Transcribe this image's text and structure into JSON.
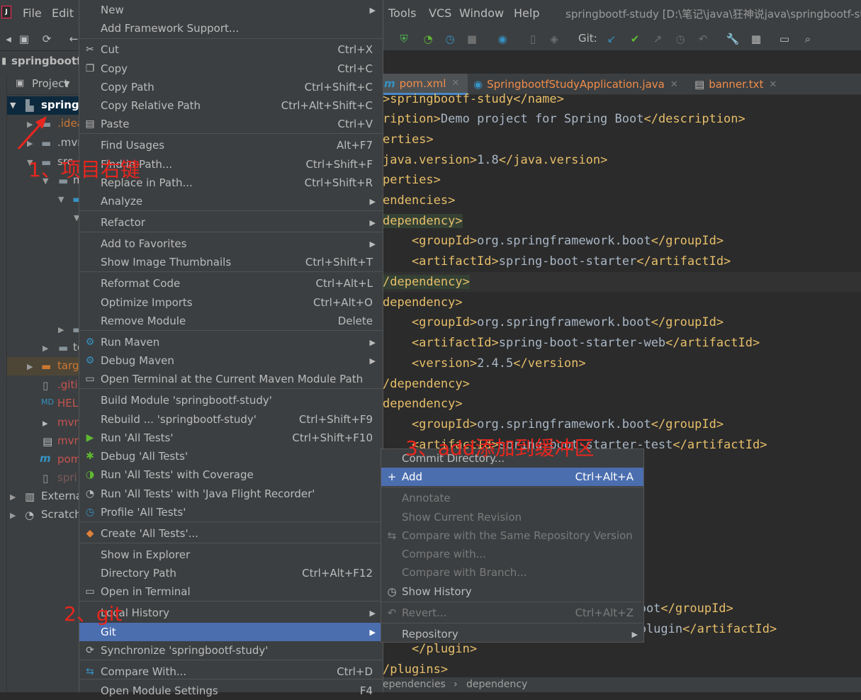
{
  "menubar": {
    "items": [
      "File",
      "Edit",
      "Tools",
      "VCS",
      "Window",
      "Help"
    ],
    "title": "springbootf-study [D:\\笔记\\java\\狂神说java\\springbootf-st"
  },
  "toolbar": {
    "git_label": "Git:"
  },
  "breadcrumb": {
    "project": "springbootf-"
  },
  "project_panel": {
    "header": "Project",
    "rows": [
      "springb",
      ".idea",
      ".mvn",
      "src",
      "m",
      "",
      "",
      "",
      "te",
      "target",
      ".giti",
      "HELI",
      "mvn",
      "mvn",
      "pom",
      "spri",
      "Externa",
      "Scratch"
    ]
  },
  "tabs": [
    {
      "label": "pom.xml"
    },
    {
      "label": "SpringbootfStudyApplication.java"
    },
    {
      "label": "banner.txt"
    }
  ],
  "editor": {
    "lines": [
      {
        "tag1": ">springbootf-study</",
        "tag2": "name>",
        "text": ""
      },
      {
        "tag1": "ription>",
        "text": "Demo project for Spring Boot",
        "tag2": "</description>"
      },
      {
        "tag1": "erties>",
        "text": "",
        "tag2": ""
      },
      {
        "tag1": "java.version>",
        "text": "1.8",
        "tag2": "</java.version>"
      },
      {
        "tag1": "perties>",
        "text": "",
        "tag2": ""
      },
      {
        "tag1": "endencies>",
        "text": "",
        "tag2": ""
      },
      {
        "tag1": "dependency>",
        "text": "",
        "tag2": ""
      },
      {
        "tag1": "    <groupId>",
        "text": "org.springframework.boot",
        "tag2": "</groupId>"
      },
      {
        "tag1": "    <artifactId>",
        "text": "spring-boot-starter",
        "tag2": "</artifactId>"
      },
      {
        "tag1": "/dependency>",
        "text": "",
        "tag2": ""
      },
      {
        "tag1": "dependency>",
        "text": "",
        "tag2": ""
      },
      {
        "tag1": "    <groupId>",
        "text": "org.springframework.boot",
        "tag2": "</groupId>"
      },
      {
        "tag1": "    <artifactId>",
        "text": "spring-boot-starter-web",
        "tag2": "</artifactId>"
      },
      {
        "tag1": "    <version>",
        "text": "2.4.5",
        "tag2": "</version>"
      },
      {
        "tag1": "/dependency>",
        "text": "",
        "tag2": ""
      },
      {
        "tag1": "dependency>",
        "text": "",
        "tag2": ""
      },
      {
        "tag1": "    <groupId>",
        "text": "org.springframework.boot",
        "tag2": "</groupId>"
      },
      {
        "tag1": "    <artifactId>",
        "text": "spring-boot-starter-test",
        "tag2": "</artifactId>"
      }
    ],
    "tail_lines": [
      {
        "tag1": "",
        "text": "k.boot",
        "tag2": "</groupId>"
      },
      {
        "tag1": "",
        "text": "en-plugin",
        "tag2": "</artifactId>"
      },
      {
        "tag1": "    </plugin>",
        "text": "",
        "tag2": ""
      },
      {
        "tag1": "/plugins>",
        "text": "",
        "tag2": ""
      }
    ]
  },
  "statusbar": {
    "crumb1": "ependencies",
    "sep": "›",
    "crumb2": "dependency"
  },
  "context_menu": {
    "items": [
      {
        "label": "New",
        "shortcut": "",
        "submenu": true
      },
      {
        "label": "Add Framework Support...",
        "shortcut": ""
      },
      {
        "label": "Cut",
        "shortcut": "Ctrl+X",
        "icon": "scissors-icon"
      },
      {
        "label": "Copy",
        "shortcut": "Ctrl+C",
        "icon": "copy-icon"
      },
      {
        "label": "Copy Path",
        "shortcut": "Ctrl+Shift+C"
      },
      {
        "label": "Copy Relative Path",
        "shortcut": "Ctrl+Alt+Shift+C"
      },
      {
        "label": "Paste",
        "shortcut": "Ctrl+V",
        "icon": "paste-icon"
      },
      {
        "label": "Find Usages",
        "shortcut": "Alt+F7"
      },
      {
        "label": "Find in Path...",
        "shortcut": "Ctrl+Shift+F"
      },
      {
        "label": "Replace in Path...",
        "shortcut": "Ctrl+Shift+R"
      },
      {
        "label": "Analyze",
        "shortcut": "",
        "submenu": true
      },
      {
        "label": "Refactor",
        "shortcut": "",
        "submenu": true
      },
      {
        "label": "Add to Favorites",
        "shortcut": "",
        "submenu": true
      },
      {
        "label": "Show Image Thumbnails",
        "shortcut": "Ctrl+Shift+T"
      },
      {
        "label": "Reformat Code",
        "shortcut": "Ctrl+Alt+L"
      },
      {
        "label": "Optimize Imports",
        "shortcut": "Ctrl+Alt+O"
      },
      {
        "label": "Remove Module",
        "shortcut": "Delete"
      },
      {
        "label": "Run Maven",
        "shortcut": "",
        "submenu": true,
        "icon": "gear-icon"
      },
      {
        "label": "Debug Maven",
        "shortcut": "",
        "submenu": true,
        "icon": "gear-icon"
      },
      {
        "label": "Open Terminal at the Current Maven Module Path",
        "shortcut": "",
        "icon": "terminal-icon"
      },
      {
        "label": "Build Module 'springbootf-study'",
        "shortcut": ""
      },
      {
        "label": "Rebuild ... 'springbootf-study'",
        "shortcut": "Ctrl+Shift+F9"
      },
      {
        "label": "Run 'All Tests'",
        "shortcut": "Ctrl+Shift+F10",
        "icon": "run-icon"
      },
      {
        "label": "Debug 'All Tests'",
        "shortcut": "",
        "icon": "debug-icon"
      },
      {
        "label": "Run 'All Tests' with Coverage",
        "shortcut": "",
        "icon": "coverage-icon"
      },
      {
        "label": "Run 'All Tests' with 'Java Flight Recorder'",
        "shortcut": "",
        "icon": "flight-recorder-icon"
      },
      {
        "label": "Profile 'All Tests'",
        "shortcut": "",
        "icon": "profile-icon"
      },
      {
        "label": "Create 'All Tests'...",
        "shortcut": "",
        "icon": "create-test-icon"
      },
      {
        "label": "Show in Explorer",
        "shortcut": ""
      },
      {
        "label": "Directory Path",
        "shortcut": "Ctrl+Alt+F12"
      },
      {
        "label": "Open in Terminal",
        "shortcut": "",
        "icon": "terminal-icon"
      },
      {
        "label": "Local History",
        "shortcut": "",
        "submenu": true
      },
      {
        "label": "Git",
        "shortcut": "",
        "submenu": true,
        "selected": true
      },
      {
        "label": "Synchronize 'springbootf-study'",
        "shortcut": "",
        "icon": "sync-icon"
      },
      {
        "label": "Compare With...",
        "shortcut": "Ctrl+D",
        "icon": "compare-icon"
      },
      {
        "label": "Open Module Settings",
        "shortcut": "F4"
      }
    ]
  },
  "git_menu": {
    "items": [
      {
        "label": "Commit Directory...",
        "shortcut": ""
      },
      {
        "label": "Add",
        "shortcut": "Ctrl+Alt+A",
        "icon": "plus-icon",
        "selected": true
      },
      {
        "label": "Annotate",
        "shortcut": "",
        "disabled": true
      },
      {
        "label": "Show Current Revision",
        "shortcut": "",
        "disabled": true
      },
      {
        "label": "Compare with the Same Repository Version",
        "shortcut": "",
        "disabled": true,
        "icon": "compare-icon"
      },
      {
        "label": "Compare with...",
        "shortcut": "",
        "disabled": true
      },
      {
        "label": "Compare with Branch...",
        "shortcut": "",
        "disabled": true
      },
      {
        "label": "Show History",
        "shortcut": "",
        "icon": "clock-icon"
      },
      {
        "label": "Revert...",
        "shortcut": "Ctrl+Alt+Z",
        "disabled": true,
        "icon": "revert-icon"
      },
      {
        "label": "Repository",
        "shortcut": "",
        "submenu": true
      }
    ]
  },
  "annotations": {
    "step1": "1、项目右键",
    "step2": "2、git",
    "step3": "3、add添加到缓冲区"
  },
  "colors": {
    "selection": "#4b6eaf",
    "annotation": "#e8261e",
    "tag": "#e8bf6a",
    "text": "#a9b7c6"
  }
}
